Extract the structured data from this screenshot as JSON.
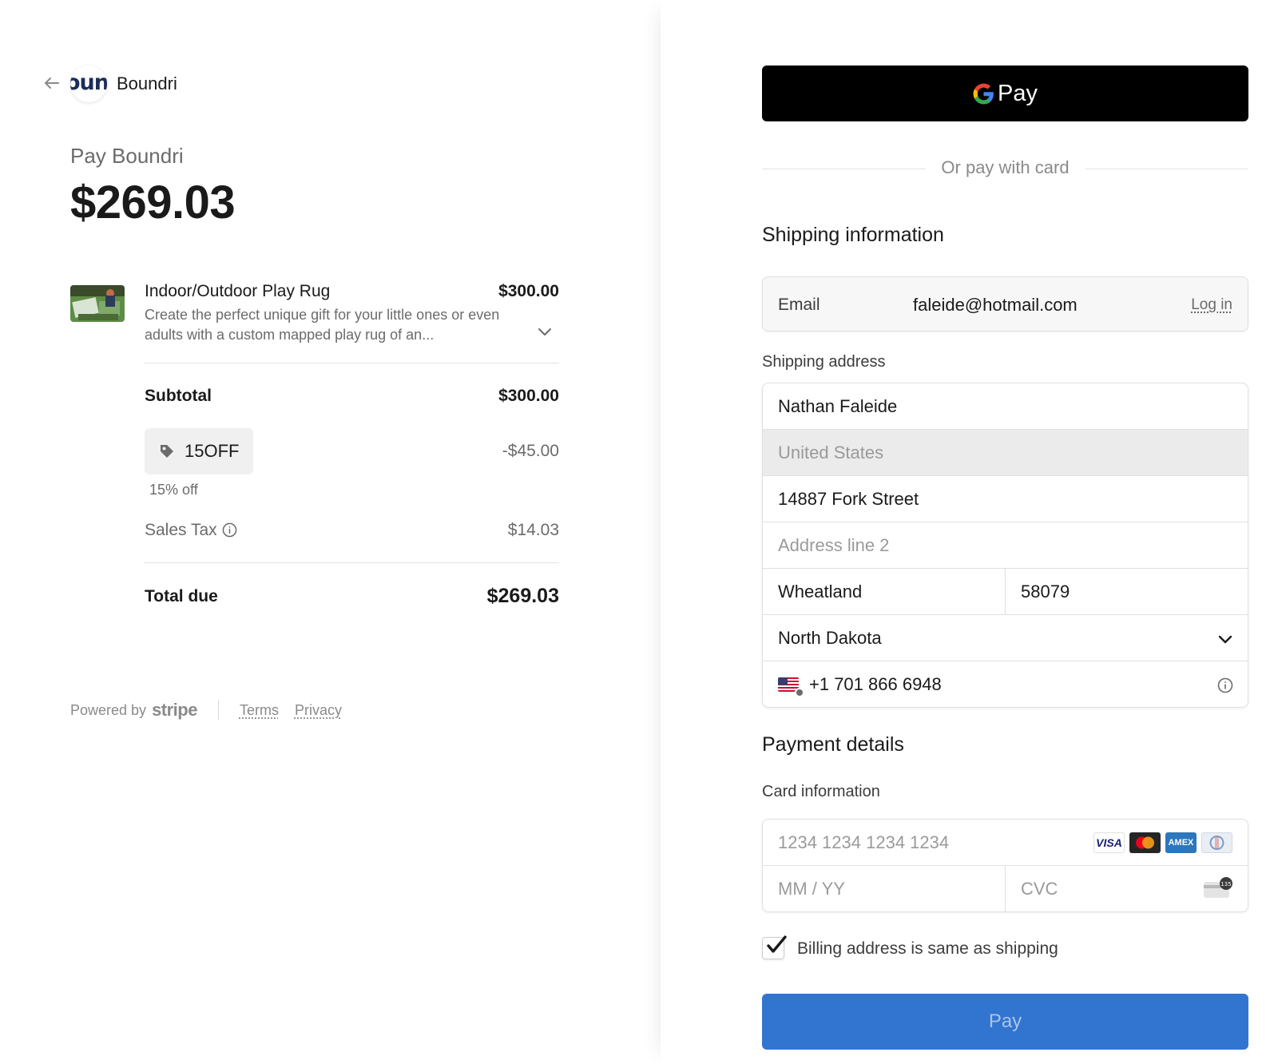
{
  "merchant": {
    "logo_text": "oun",
    "name": "Boundri"
  },
  "summary": {
    "pay_label": "Pay Boundri",
    "amount": "$269.03"
  },
  "product": {
    "name": "Indoor/Outdoor Play Rug",
    "price": "$300.00",
    "description": "Create the perfect unique gift for your little ones or even adults with a custom mapped play rug of an..."
  },
  "totals": {
    "subtotal_label": "Subtotal",
    "subtotal_value": "$300.00",
    "promo_code": "15OFF",
    "promo_discount": "-$45.00",
    "promo_note": "15% off",
    "tax_label": "Sales Tax",
    "tax_value": "$14.03",
    "total_label": "Total due",
    "total_value": "$269.03"
  },
  "footer": {
    "powered_by": "Powered by",
    "stripe": "stripe",
    "terms": "Terms",
    "privacy": "Privacy"
  },
  "gpay": {
    "label": "Pay"
  },
  "or_text": "Or pay with card",
  "shipping": {
    "title": "Shipping information",
    "email_label": "Email",
    "email_value": "faleide@hotmail.com",
    "login_link": "Log in",
    "address_label": "Shipping address",
    "name": "Nathan Faleide",
    "country": "United States",
    "line1": "14887 Fork Street",
    "line2_placeholder": "Address line 2",
    "city": "Wheatland",
    "zip": "58079",
    "state": "North Dakota",
    "phone": "+1 701 866 6948"
  },
  "payment": {
    "title": "Payment details",
    "card_label": "Card information",
    "card_number_placeholder": "1234 1234 1234 1234",
    "expiry_placeholder": "MM / YY",
    "cvc_placeholder": "CVC",
    "card_brands": [
      "VISA",
      "mastercard",
      "AMEX",
      "diners"
    ],
    "cvc_badge": "135"
  },
  "billing_same": {
    "label": "Billing address is same as shipping",
    "checked": true
  },
  "pay_button": {
    "label": "Pay"
  },
  "colors": {
    "accent": "#3275d0",
    "gpay_bg": "#000000"
  }
}
